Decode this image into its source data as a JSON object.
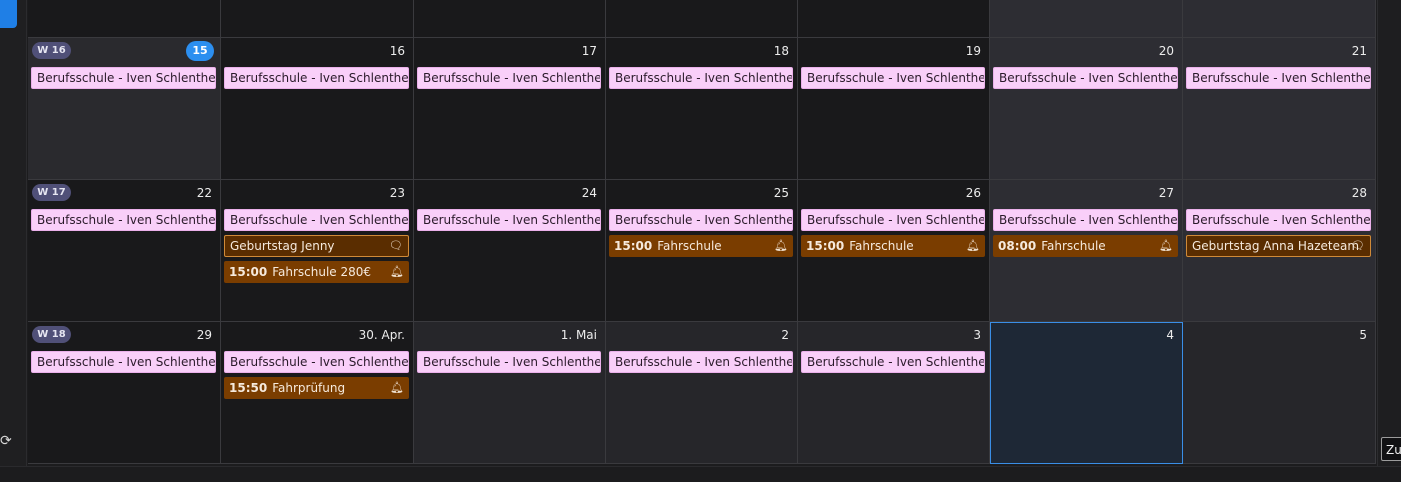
{
  "weeks": [
    {
      "label": "W 16",
      "days": [
        {
          "num": "15",
          "today": true,
          "bg": "week",
          "events": [
            {
              "type": "school",
              "text": "Berufsschule - Iven Schlenther"
            }
          ]
        },
        {
          "num": "16",
          "bg": "dark",
          "events": [
            {
              "type": "school",
              "text": "Berufsschule - Iven Schlenther"
            }
          ]
        },
        {
          "num": "17",
          "bg": "dark",
          "events": [
            {
              "type": "school",
              "text": "Berufsschule - Iven Schlenther"
            }
          ]
        },
        {
          "num": "18",
          "bg": "dark",
          "events": [
            {
              "type": "school",
              "text": "Berufsschule - Iven Schlenther"
            }
          ]
        },
        {
          "num": "19",
          "bg": "dark",
          "events": [
            {
              "type": "school",
              "text": "Berufsschule - Iven Schlenther"
            }
          ]
        },
        {
          "num": "20",
          "bg": "we",
          "events": [
            {
              "type": "school",
              "text": "Berufsschule - Iven Schlenther"
            }
          ]
        },
        {
          "num": "21",
          "bg": "we",
          "events": [
            {
              "type": "school",
              "text": "Berufsschule - Iven Schlenther"
            }
          ]
        }
      ]
    },
    {
      "label": "W 17",
      "days": [
        {
          "num": "22",
          "bg": "dark",
          "events": [
            {
              "type": "school",
              "text": "Berufsschule - Iven Schlenther"
            }
          ]
        },
        {
          "num": "23",
          "bg": "dark",
          "events": [
            {
              "type": "school",
              "text": "Berufsschule - Iven Schlenther"
            },
            {
              "type": "bday",
              "text": "Geburtstag Jenny",
              "icon": "comment-icon"
            },
            {
              "type": "orange",
              "time": "15:00",
              "text": "Fahrschule 280€",
              "icon": "bell-icon"
            }
          ]
        },
        {
          "num": "24",
          "bg": "dark",
          "events": [
            {
              "type": "school",
              "text": "Berufsschule - Iven Schlenther"
            }
          ]
        },
        {
          "num": "25",
          "bg": "dark",
          "events": [
            {
              "type": "school",
              "text": "Berufsschule - Iven Schlenther"
            },
            {
              "type": "orange",
              "time": "15:00",
              "text": "Fahrschule",
              "icon": "bell-icon"
            }
          ]
        },
        {
          "num": "26",
          "bg": "dark",
          "events": [
            {
              "type": "school",
              "text": "Berufsschule - Iven Schlenther"
            },
            {
              "type": "orange",
              "time": "15:00",
              "text": "Fahrschule",
              "icon": "bell-icon"
            }
          ]
        },
        {
          "num": "27",
          "bg": "we",
          "events": [
            {
              "type": "school",
              "text": "Berufsschule - Iven Schlenther"
            },
            {
              "type": "orange",
              "time": "08:00",
              "text": "Fahrschule",
              "icon": "bell-icon"
            }
          ]
        },
        {
          "num": "28",
          "bg": "we",
          "events": [
            {
              "type": "school",
              "text": "Berufsschule - Iven Schlenther"
            },
            {
              "type": "bday",
              "text": "Geburtstag Anna Hazeteam",
              "icon": "comment-icon"
            }
          ]
        }
      ]
    },
    {
      "label": "W 18",
      "days": [
        {
          "num": "29",
          "bg": "dark",
          "events": [
            {
              "type": "school",
              "text": "Berufsschule - Iven Schlenther"
            }
          ]
        },
        {
          "num": "30. Apr.",
          "bg": "dark",
          "events": [
            {
              "type": "school",
              "text": "Berufsschule - Iven Schlenther"
            },
            {
              "type": "orange",
              "time": "15:50",
              "text": "Fahrprüfung",
              "icon": "bell-icon"
            }
          ]
        },
        {
          "num": "1. Mai",
          "bg": "mute",
          "events": [
            {
              "type": "school",
              "text": "Berufsschule - Iven Schlenther"
            }
          ]
        },
        {
          "num": "2",
          "bg": "mute",
          "events": [
            {
              "type": "school",
              "text": "Berufsschule - Iven Schlenther"
            }
          ]
        },
        {
          "num": "3",
          "bg": "mute",
          "events": [
            {
              "type": "school",
              "text": "Berufsschule - Iven Schlenther"
            }
          ]
        },
        {
          "num": "4",
          "bg": "mute",
          "selected": true,
          "events": []
        },
        {
          "num": "5",
          "bg": "mute",
          "events": []
        }
      ]
    }
  ],
  "prev_row_bgs": [
    "dark",
    "dark",
    "dark",
    "dark",
    "dark",
    "we",
    "we"
  ],
  "tooltip": "Zur",
  "colors": {
    "accent": "#2c8ff0",
    "school": "#f9cff9",
    "orange": "#7a3d00"
  },
  "icons": {
    "sync": "sync-icon"
  }
}
